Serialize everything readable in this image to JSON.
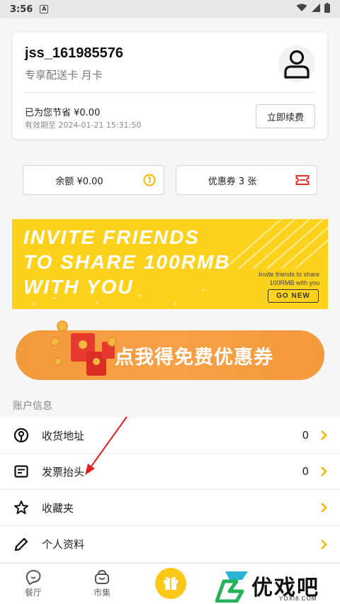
{
  "status_bar": {
    "time": "3:56",
    "notification_icon": "a-notification-icon",
    "wifi_icon": "wifi-icon",
    "signal_icon": "signal-icon",
    "battery_icon": "battery-icon"
  },
  "member_card": {
    "username": "jss_161985576",
    "card_type": "专享配送卡 月卡",
    "saved_text": "已为您节省 ¥0.00",
    "expire_text": "有效期至 2024-01-21 15:31:50",
    "renew_label": "立即续费",
    "avatar_icon": "user-avatar-icon"
  },
  "wallet": {
    "balance_label": "余额 ¥0.00",
    "balance_icon": "coin-icon",
    "coupon_label": "优惠券 3 张",
    "coupon_icon": "ticket-icon"
  },
  "invite_banner": {
    "line1": "INVITE FRIENDS",
    "line2": "TO SHARE 100RMB",
    "line3": "WITH YOU",
    "sub1": "Invite friends to share",
    "sub2": "100RMB with you",
    "button": "GO NEW"
  },
  "coupon_banner": {
    "text": "点我得免费优惠券"
  },
  "account_section": {
    "title": "账户信息",
    "items": [
      {
        "label": "收货地址",
        "count": "0",
        "icon": "location-pin-icon"
      },
      {
        "label": "发票抬头",
        "count": "0",
        "icon": "invoice-icon"
      },
      {
        "label": "收藏夹",
        "count": "",
        "icon": "star-icon"
      },
      {
        "label": "个人资料",
        "count": "",
        "icon": "pencil-icon"
      }
    ]
  },
  "tab_bar": {
    "tabs": [
      {
        "label": "餐厅",
        "icon": "restaurant-icon"
      },
      {
        "label": "市集",
        "icon": "market-basket-icon"
      },
      {
        "label": "",
        "icon": "gift-icon"
      }
    ]
  },
  "watermark": {
    "text": "优戏吧",
    "url": "YOXI8.COM"
  },
  "colors": {
    "accent_yellow": "#fdd21c",
    "arrow_yellow": "#f5b800",
    "coupon_orange": "#f59a3c",
    "annotation_red": "#e02020"
  }
}
